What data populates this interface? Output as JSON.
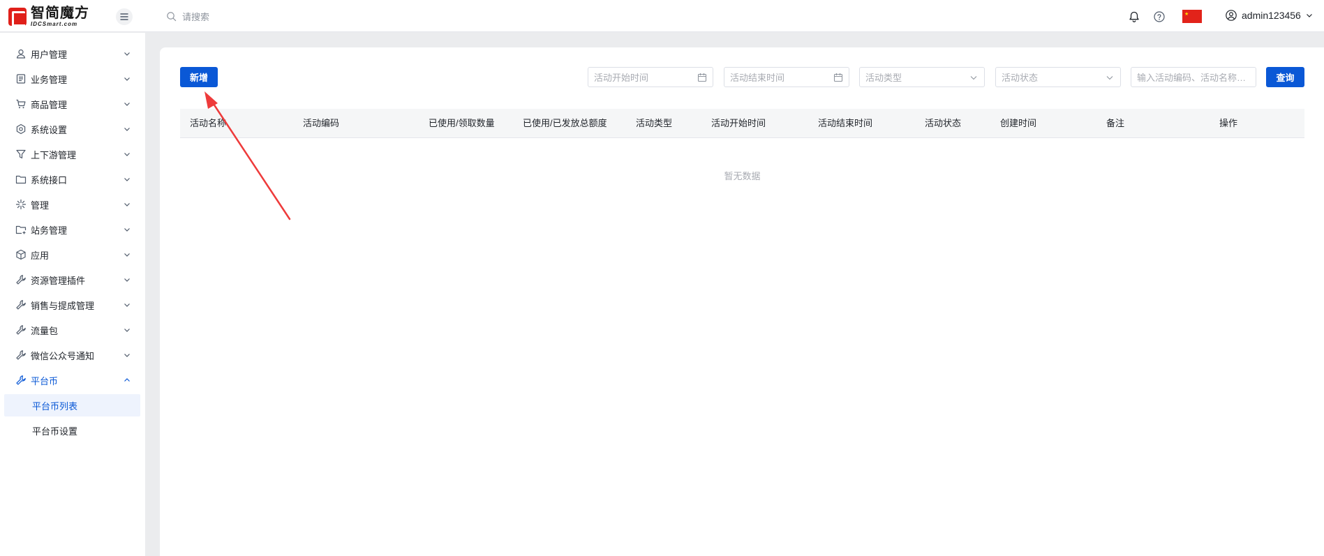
{
  "app": {
    "logo_cn": "智简魔方",
    "logo_en": "IDCSmart.com"
  },
  "topbar": {
    "search_placeholder": "请搜索",
    "username": "admin123456",
    "icons": [
      "menu-icon",
      "search-icon",
      "bell-icon",
      "help-icon",
      "china-flag-icon",
      "user-circle-icon",
      "chevron-down-icon"
    ]
  },
  "sidebar": {
    "items": [
      {
        "label": "用户管理",
        "icon": "user-icon"
      },
      {
        "label": "业务管理",
        "icon": "document-list-icon"
      },
      {
        "label": "商品管理",
        "icon": "cart-icon"
      },
      {
        "label": "系统设置",
        "icon": "gear-icon"
      },
      {
        "label": "上下游管理",
        "icon": "filter-icon"
      },
      {
        "label": "系统接口",
        "icon": "folder-icon"
      },
      {
        "label": "管理",
        "icon": "sparkle-icon"
      },
      {
        "label": "站务管理",
        "icon": "folder-plus-icon"
      },
      {
        "label": "应用",
        "icon": "box-icon"
      },
      {
        "label": "资源管理插件",
        "icon": "wrench-icon"
      },
      {
        "label": "销售与提成管理",
        "icon": "wrench-icon"
      },
      {
        "label": "流量包",
        "icon": "wrench-icon"
      },
      {
        "label": "微信公众号通知",
        "icon": "wrench-icon"
      },
      {
        "label": "平台币",
        "icon": "wrench-icon"
      }
    ],
    "sub_items": [
      {
        "label": "平台币列表"
      },
      {
        "label": "平台币设置"
      }
    ]
  },
  "toolbar": {
    "add_label": "新增",
    "start_time_placeholder": "活动开始时间",
    "end_time_placeholder": "活动结束时间",
    "type_placeholder": "活动类型",
    "status_placeholder": "活动状态",
    "keyword_placeholder": "输入活动编码、活动名称查...",
    "query_label": "查询"
  },
  "table": {
    "columns": [
      "活动名称",
      "活动编码",
      "已使用/领取数量",
      "已使用/已发放总额度",
      "活动类型",
      "活动开始时间",
      "活动结束时间",
      "活动状态",
      "创建时间",
      "备注",
      "操作"
    ],
    "empty_text": "暂无数据"
  },
  "colors": {
    "primary": "#0a58d6",
    "arrow": "#ee3b3b",
    "logo_red": "#e0201a"
  }
}
